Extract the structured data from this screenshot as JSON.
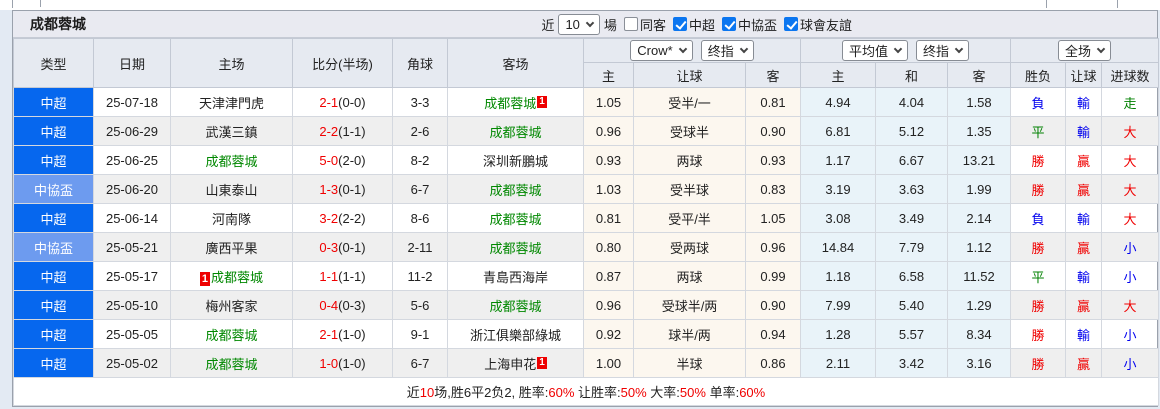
{
  "title_bar": {
    "team": "成都蓉城",
    "recent_prefix": "近",
    "recent_count": "10",
    "recent_suffix": "場",
    "filters": [
      {
        "label": "同客",
        "checked": false
      },
      {
        "label": "中超",
        "checked": true
      },
      {
        "label": "中協盃",
        "checked": true
      },
      {
        "label": "球會友誼",
        "checked": true
      }
    ]
  },
  "header": {
    "static_columns": [
      "类型",
      "日期",
      "主场",
      "比分(半场)",
      "角球",
      "客场"
    ],
    "selects": {
      "crow_company": "Crow*",
      "crow_index": "终指",
      "avg_source": "平均值",
      "avg_index": "终指",
      "scope": "全场"
    },
    "odds_subcolumns": [
      "主",
      "让球",
      "客"
    ],
    "avg_subcolumns": [
      "主",
      "和",
      "客"
    ],
    "result_columns": [
      "胜负",
      "让球",
      "进球数"
    ]
  },
  "rows": [
    {
      "type": "中超",
      "cup": false,
      "date": "25-07-18",
      "home": {
        "name": "天津津門虎",
        "hl": false
      },
      "score_full": "2-1",
      "score_half": "(0-0)",
      "corners": "3-3",
      "away": {
        "name": "成都蓉城",
        "hl": true,
        "badge_after": "1"
      },
      "odds": [
        "1.05",
        "受半/一",
        "0.81"
      ],
      "avg": [
        "4.94",
        "4.04",
        "1.58"
      ],
      "results": [
        [
          "負",
          "blue"
        ],
        [
          "輸",
          "blue"
        ],
        [
          "走",
          "green"
        ]
      ]
    },
    {
      "type": "中超",
      "cup": false,
      "date": "25-06-29",
      "home": {
        "name": "武漢三鎮",
        "hl": false
      },
      "score_full": "2-2",
      "score_half": "(1-1)",
      "corners": "2-6",
      "away": {
        "name": "成都蓉城",
        "hl": true
      },
      "odds": [
        "0.96",
        "受球半",
        "0.90"
      ],
      "avg": [
        "6.81",
        "5.12",
        "1.35"
      ],
      "results": [
        [
          "平",
          "green"
        ],
        [
          "輸",
          "blue"
        ],
        [
          "大",
          "red"
        ]
      ]
    },
    {
      "type": "中超",
      "cup": false,
      "date": "25-06-25",
      "home": {
        "name": "成都蓉城",
        "hl": true
      },
      "score_full": "5-0",
      "score_half": "(2-0)",
      "corners": "8-2",
      "away": {
        "name": "深圳新鵬城",
        "hl": false
      },
      "odds": [
        "0.93",
        "两球",
        "0.93"
      ],
      "avg": [
        "1.17",
        "6.67",
        "13.21"
      ],
      "results": [
        [
          "勝",
          "red"
        ],
        [
          "贏",
          "red"
        ],
        [
          "大",
          "red"
        ]
      ]
    },
    {
      "type": "中協盃",
      "cup": true,
      "date": "25-06-20",
      "home": {
        "name": "山東泰山",
        "hl": false
      },
      "score_full": "1-3",
      "score_half": "(0-1)",
      "corners": "6-7",
      "away": {
        "name": "成都蓉城",
        "hl": true
      },
      "odds": [
        "1.03",
        "受半球",
        "0.83"
      ],
      "avg": [
        "3.19",
        "3.63",
        "1.99"
      ],
      "results": [
        [
          "勝",
          "red"
        ],
        [
          "贏",
          "red"
        ],
        [
          "大",
          "red"
        ]
      ]
    },
    {
      "type": "中超",
      "cup": false,
      "date": "25-06-14",
      "home": {
        "name": "河南隊",
        "hl": false
      },
      "score_full": "3-2",
      "score_half": "(2-2)",
      "corners": "8-6",
      "away": {
        "name": "成都蓉城",
        "hl": true
      },
      "odds": [
        "0.81",
        "受平/半",
        "1.05"
      ],
      "avg": [
        "3.08",
        "3.49",
        "2.14"
      ],
      "results": [
        [
          "負",
          "blue"
        ],
        [
          "輸",
          "blue"
        ],
        [
          "大",
          "red"
        ]
      ]
    },
    {
      "type": "中協盃",
      "cup": true,
      "date": "25-05-21",
      "home": {
        "name": "廣西平果",
        "hl": false
      },
      "score_full": "0-3",
      "score_half": "(0-1)",
      "corners": "2-11",
      "away": {
        "name": "成都蓉城",
        "hl": true
      },
      "odds": [
        "0.80",
        "受两球",
        "0.96"
      ],
      "avg": [
        "14.84",
        "7.79",
        "1.12"
      ],
      "results": [
        [
          "勝",
          "red"
        ],
        [
          "贏",
          "red"
        ],
        [
          "小",
          "blue"
        ]
      ]
    },
    {
      "type": "中超",
      "cup": false,
      "date": "25-05-17",
      "home": {
        "name": "成都蓉城",
        "hl": true,
        "badge_before": "1"
      },
      "score_full": "1-1",
      "score_half": "(1-1)",
      "corners": "11-2",
      "away": {
        "name": "青島西海岸",
        "hl": false
      },
      "odds": [
        "0.87",
        "两球",
        "0.99"
      ],
      "avg": [
        "1.18",
        "6.58",
        "11.52"
      ],
      "results": [
        [
          "平",
          "green"
        ],
        [
          "輸",
          "blue"
        ],
        [
          "小",
          "blue"
        ]
      ]
    },
    {
      "type": "中超",
      "cup": false,
      "date": "25-05-10",
      "home": {
        "name": "梅州客家",
        "hl": false
      },
      "score_full": "0-4",
      "score_half": "(0-3)",
      "corners": "5-6",
      "away": {
        "name": "成都蓉城",
        "hl": true
      },
      "odds": [
        "0.96",
        "受球半/两",
        "0.90"
      ],
      "avg": [
        "7.99",
        "5.40",
        "1.29"
      ],
      "results": [
        [
          "勝",
          "red"
        ],
        [
          "贏",
          "red"
        ],
        [
          "大",
          "red"
        ]
      ]
    },
    {
      "type": "中超",
      "cup": false,
      "date": "25-05-05",
      "home": {
        "name": "成都蓉城",
        "hl": true
      },
      "score_full": "2-1",
      "score_half": "(1-0)",
      "corners": "9-1",
      "away": {
        "name": "浙江俱樂部綠城",
        "hl": false
      },
      "odds": [
        "0.92",
        "球半/两",
        "0.94"
      ],
      "avg": [
        "1.28",
        "5.57",
        "8.34"
      ],
      "results": [
        [
          "勝",
          "red"
        ],
        [
          "輸",
          "blue"
        ],
        [
          "小",
          "blue"
        ]
      ]
    },
    {
      "type": "中超",
      "cup": false,
      "date": "25-05-02",
      "home": {
        "name": "成都蓉城",
        "hl": true
      },
      "score_full": "1-0",
      "score_half": "(1-0)",
      "corners": "6-7",
      "away": {
        "name": "上海申花",
        "hl": false,
        "badge_after": "1"
      },
      "odds": [
        "1.00",
        "半球",
        "0.86"
      ],
      "avg": [
        "2.11",
        "3.42",
        "3.16"
      ],
      "results": [
        [
          "勝",
          "red"
        ],
        [
          "贏",
          "red"
        ],
        [
          "小",
          "blue"
        ]
      ]
    }
  ],
  "footer": {
    "segments": [
      {
        "text": "近"
      },
      {
        "text": "10",
        "red": true
      },
      {
        "text": "场,胜6平2负2, 胜率:"
      },
      {
        "text": "60%",
        "red": true
      },
      {
        "text": " 让胜率:"
      },
      {
        "text": "50%",
        "red": true
      },
      {
        "text": " 大率:"
      },
      {
        "text": "50%",
        "red": true
      },
      {
        "text": " 单率:"
      },
      {
        "text": "60%",
        "red": true
      }
    ]
  },
  "colors": {
    "league_type_bg": "#0667EE",
    "cup_type_bg": "#6D9BEF",
    "team_highlight": "#008800",
    "score_red": "#F00000",
    "result_win_red": "#F00000",
    "result_lose_blue": "#0000EE",
    "result_draw_green": "#008000",
    "odds_columns_bg": "#FCF7EF",
    "avg_columns_bg": "#E9F3F9",
    "checkbox_accent": "#0B76F0",
    "red_card_badge_bg": "#EE0000"
  }
}
